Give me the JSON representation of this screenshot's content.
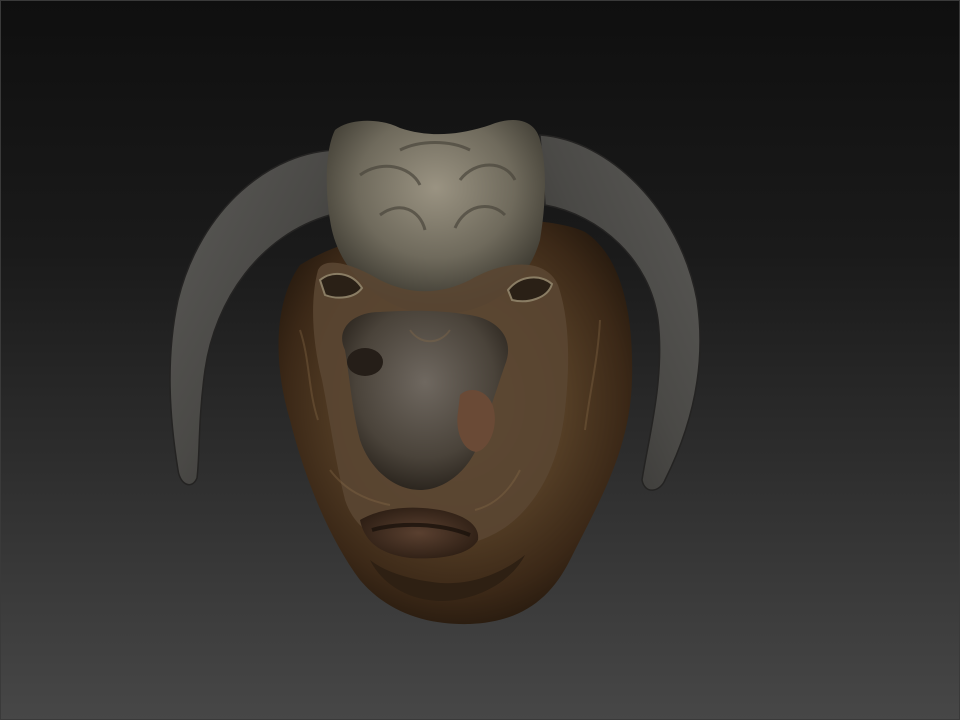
{
  "scene": {
    "background_top": "#0f0f0f",
    "background_bottom": "#474747",
    "horn_color": "#4b4b48",
    "skin_dark": "#3a2a1a",
    "skin_mid": "#6b5132",
    "skin_light": "#9c8a6c",
    "brow_color": "#7d786a",
    "subject_icon": "bull-head-sculpt-icon"
  }
}
